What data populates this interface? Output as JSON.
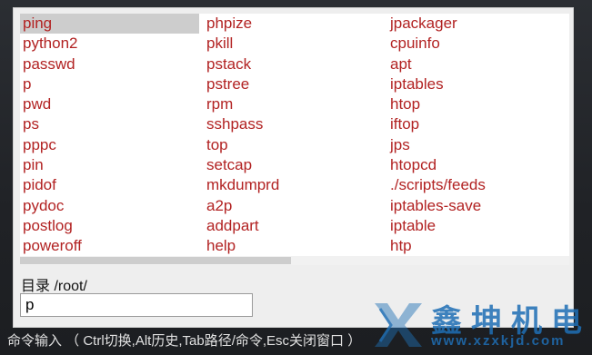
{
  "commands": {
    "column_1": [
      "ping",
      "python2",
      "passwd",
      "p",
      "pwd",
      "ps",
      "pppc",
      "pin",
      "pidof",
      "pydoc",
      "postlog",
      "poweroff"
    ],
    "column_2": [
      "phpize",
      "pkill",
      "pstack",
      "pstree",
      "rpm",
      "sshpass",
      "top",
      "setcap",
      "mkdumprd",
      "a2p",
      "addpart",
      "help"
    ],
    "column_3": [
      "jpackager",
      "cpuinfo",
      "apt",
      "iptables",
      "htop",
      "iftop",
      "jps",
      "htopcd",
      "./scripts/feeds",
      "iptables-save",
      "iptable",
      "htp"
    ],
    "selected": "ping"
  },
  "directory": {
    "label": "目录 /root/"
  },
  "input": {
    "value": "p"
  },
  "status_bar": {
    "text": "命令输入 （ Ctrl切换,Alt历史,Tab路径/命令,Esc关闭窗口 ）"
  },
  "watermark": {
    "chinese": "鑫坤机电",
    "url": "www.xzxkjd.com"
  },
  "colors": {
    "command_text": "#b22222",
    "selection": "#cdcdcd",
    "watermark": "#1f6fb5"
  }
}
